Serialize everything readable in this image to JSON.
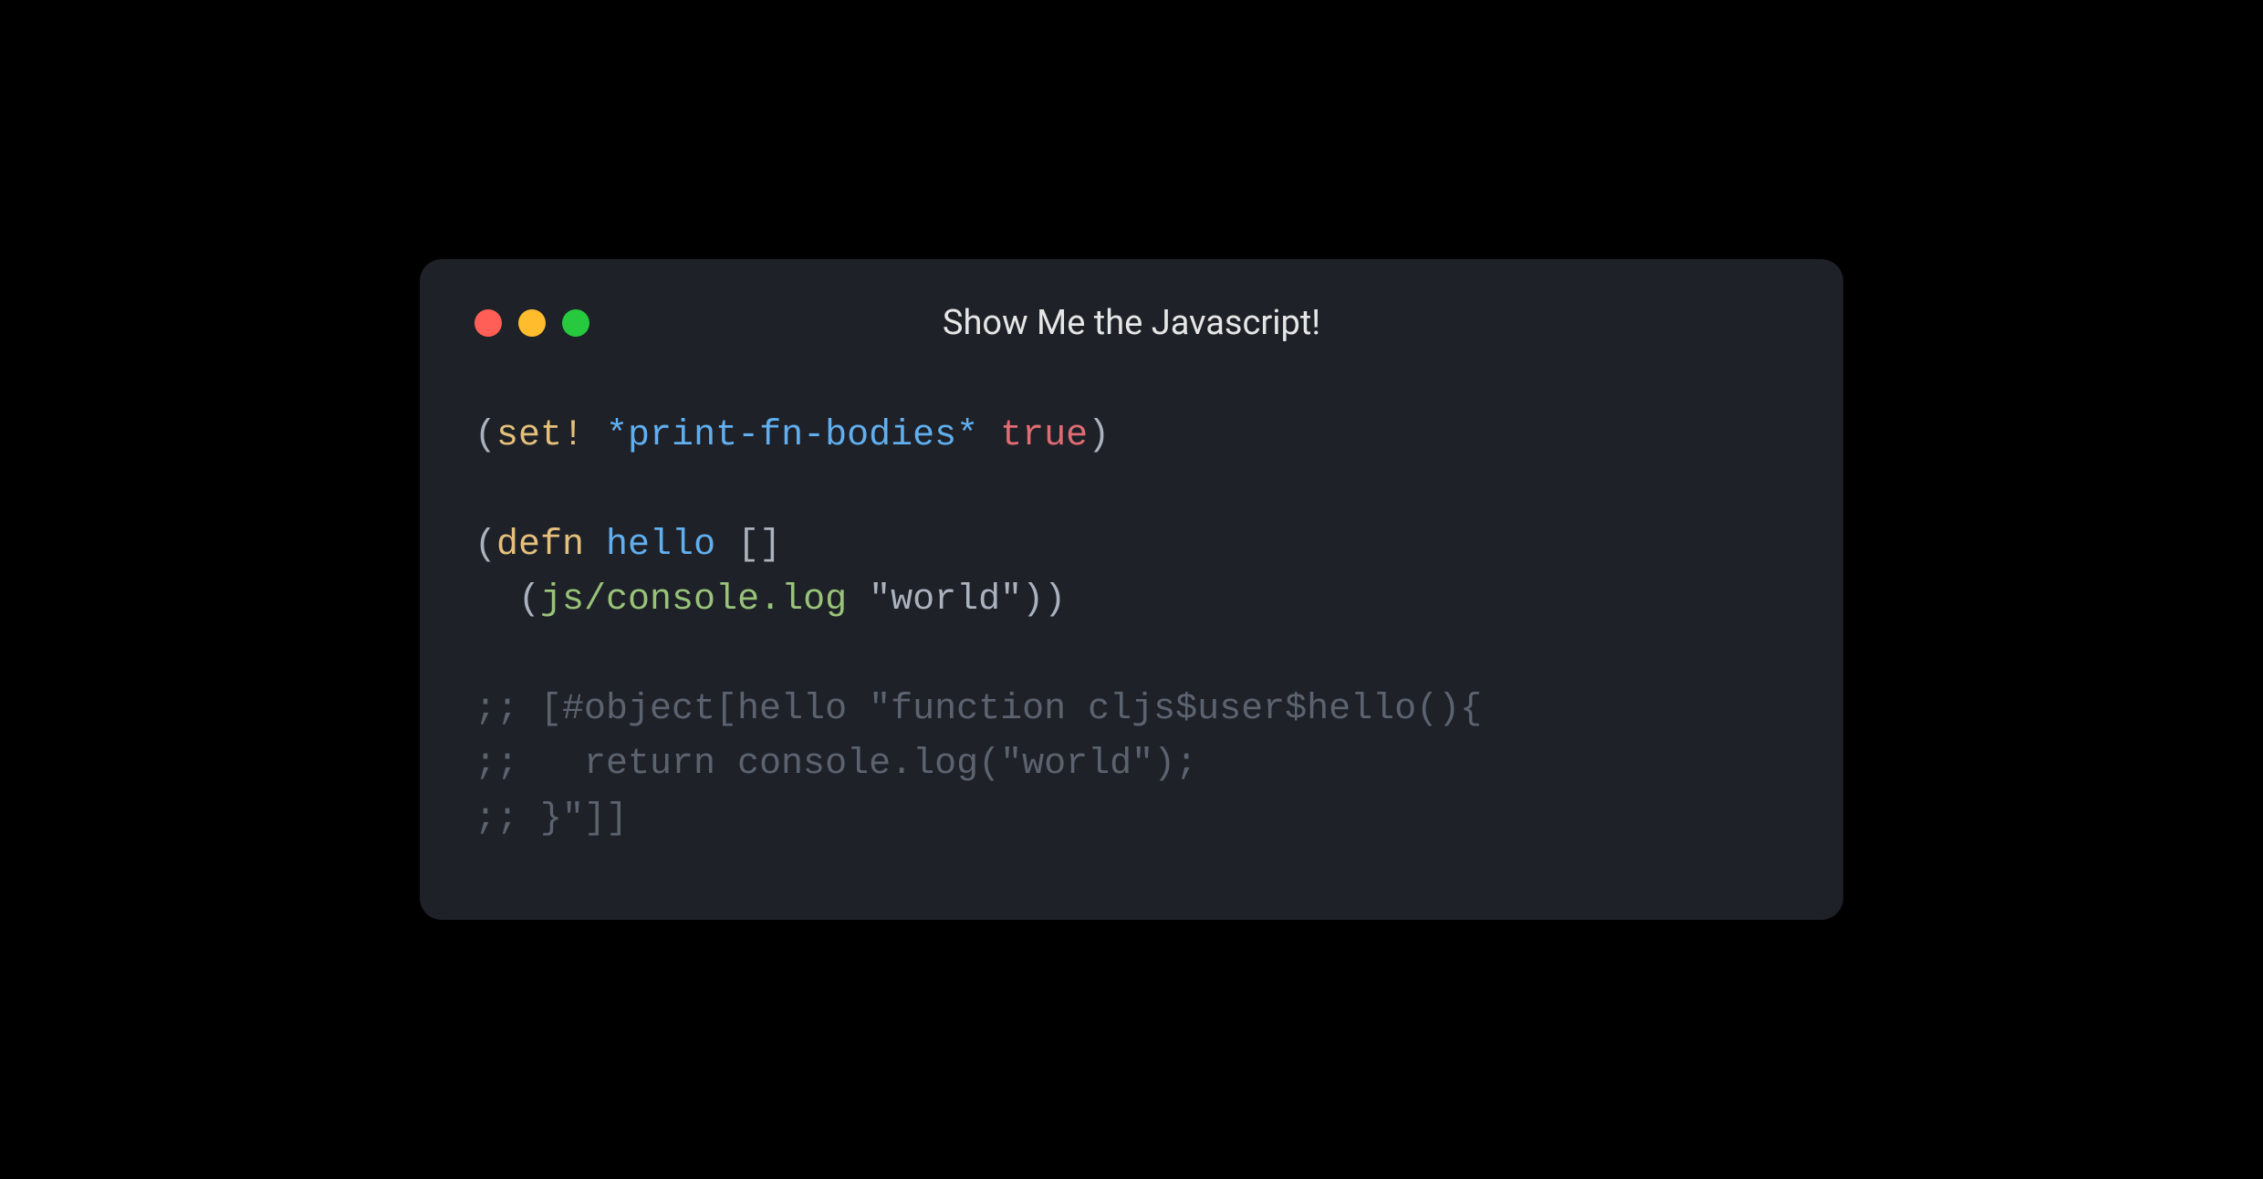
{
  "window": {
    "title": "Show Me the Javascript!"
  },
  "code": {
    "line1": {
      "open": "(",
      "set": "set!",
      "sp1": " ",
      "var": "*print-fn-bodies*",
      "sp2": " ",
      "val": "true",
      "close": ")"
    },
    "blank1": "",
    "line2": {
      "open": "(",
      "defn": "defn",
      "sp1": " ",
      "name": "hello",
      "sp2": " ",
      "brackets": "[]"
    },
    "line3": {
      "indent": "  ",
      "open": "(",
      "fn": "js/console.log",
      "sp": " ",
      "str": "\"world\"",
      "close": "))"
    },
    "blank2": "",
    "line4": ";; [#object[hello \"function cljs$user$hello(){",
    "line5": ";;   return console.log(\"world\");",
    "line6": ";; }\"]]"
  }
}
